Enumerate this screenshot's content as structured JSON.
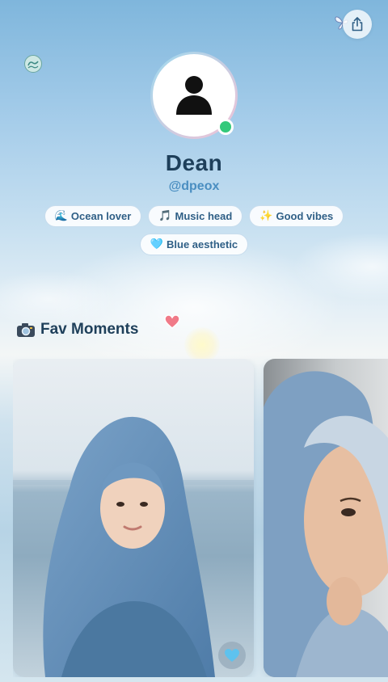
{
  "profile": {
    "name": "Dean",
    "handle": "@dpeox",
    "online": true
  },
  "tags": [
    {
      "emoji": "🌊",
      "label": "Ocean lover"
    },
    {
      "emoji": "🎵",
      "label": "Music head"
    },
    {
      "emoji": "✨",
      "label": "Good vibes"
    },
    {
      "emoji": "🩵",
      "label": "Blue aesthetic"
    }
  ],
  "moments_section": {
    "emoji": "📸",
    "title": "Fav Moments"
  },
  "moments": [
    {
      "icon": "photo-woman-blue-hijab-beach"
    },
    {
      "icon": "photo-woman-blue-hood-closeup"
    }
  ],
  "icons": {
    "share": "share-icon",
    "reaction": "blue-heart-icon"
  },
  "colors": {
    "accent": "#4a8ec1",
    "name": "#1e3f5a",
    "online": "#34c97b"
  }
}
